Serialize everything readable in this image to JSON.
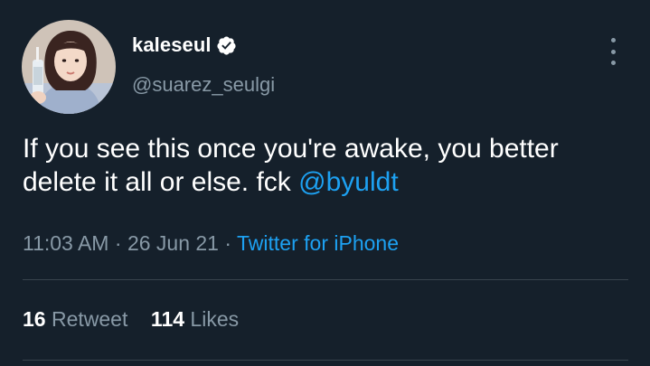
{
  "tweet": {
    "author": {
      "display_name": "kaleseul",
      "handle": "@suarez_seulgi",
      "verified": true,
      "avatar": "profile-photo"
    },
    "text_before": "If you see this once you're awake, you better delete it all or else. fck ",
    "mention": "@byuldt",
    "time": "11:03 AM",
    "sep1": "·",
    "date": "26 Jun 21",
    "sep2": "·",
    "source": "Twitter for iPhone",
    "retweet_count": "16",
    "retweet_label": "Retweet",
    "like_count": "114",
    "like_label": "Likes"
  },
  "colors": {
    "background": "#15202b",
    "text": "#ffffff",
    "secondary": "#8899a6",
    "accent": "#1da1f2",
    "divider": "#38444d"
  },
  "icons": {
    "verified": "verified-badge-icon",
    "more": "more-vertical-icon"
  }
}
